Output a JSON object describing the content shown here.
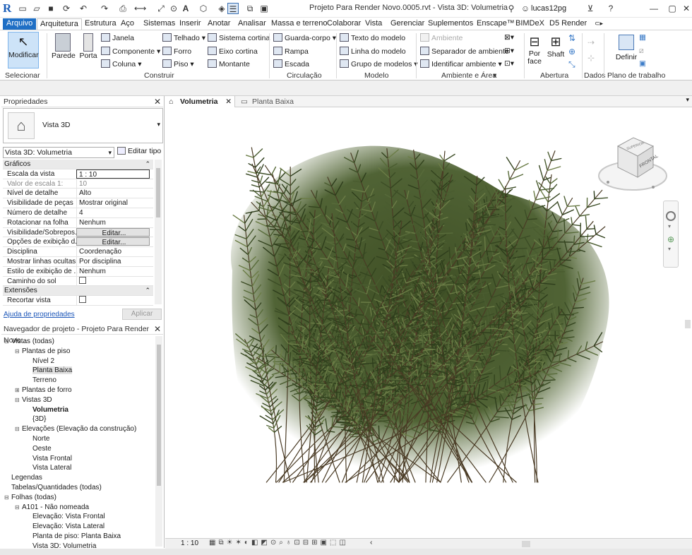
{
  "title_bar": {
    "app_letter": "R",
    "title": "Projeto Para Render Novo.0005.rvt - Vista 3D: Volumetria",
    "user": "lucas12pg"
  },
  "menu": {
    "file": "Arquivo",
    "tabs": [
      "Arquitetura",
      "Estrutura",
      "Aço",
      "Sistemas",
      "Inserir",
      "Anotar",
      "Analisar",
      "Massa e terreno",
      "Colaborar",
      "Vista",
      "Gerenciar",
      "Suplementos",
      "Enscape™",
      "BIMDeX",
      "D5 Render"
    ]
  },
  "ribbon": {
    "modificar": "Modificar",
    "selecionar": "Selecionar",
    "parede": "Parede",
    "porta": "Porta",
    "janela": "Janela",
    "componente": "Componente",
    "coluna": "Coluna",
    "telhado": "Telhado",
    "forro": "Forro",
    "piso": "Piso",
    "sistema_cortina": "Sistema cortina",
    "eixo_cortina": "Eixo cortina",
    "montante": "Montante",
    "construir": "Construir",
    "guarda_corpo": "Guarda-corpo",
    "rampa": "Rampa",
    "escada": "Escada",
    "circulacao": "Circulação",
    "texto_modelo": "Texto do modelo",
    "linha_modelo": "Linha do modelo",
    "grupo_modelos": "Grupo de modelos",
    "modelo": "Modelo",
    "ambiente": "Ambiente",
    "separador_ambiente": "Separador de ambiente",
    "identificar_ambiente": "Identificar ambiente",
    "ambiente_area": "Ambiente e Área",
    "por_face": "Por face",
    "shaft": "Shaft",
    "abertura": "Abertura",
    "dados": "Dados",
    "definir": "Definir",
    "plano_trabalho": "Plano de trabalho"
  },
  "properties": {
    "title": "Propriedades",
    "type_name": "Vista 3D",
    "instance_select": "Vista 3D: Volumetria",
    "edit_type": "Editar tipo",
    "group_graficos": "Gráficos",
    "group_extensoes": "Extensões",
    "rows": [
      {
        "k": "Escala da vista",
        "v": "1 : 10"
      },
      {
        "k": "Valor de escala    1:",
        "v": "10"
      },
      {
        "k": "Nível de detalhe",
        "v": "Alto"
      },
      {
        "k": "Visibilidade de peças",
        "v": "Mostrar original"
      },
      {
        "k": "Número de detalhe",
        "v": "4"
      },
      {
        "k": "Rotacionar na folha",
        "v": "Nenhum"
      },
      {
        "k": "Visibilidade/Sobrepos...",
        "v": "Editar..."
      },
      {
        "k": "Opções de exibição d...",
        "v": "Editar..."
      },
      {
        "k": "Disciplina",
        "v": "Coordenação"
      },
      {
        "k": "Mostrar linhas ocultas",
        "v": "Por disciplina"
      },
      {
        "k": "Estilo de exibição de ...",
        "v": "Nenhum"
      },
      {
        "k": "Caminho do sol",
        "v": ""
      }
    ],
    "ext_rows": [
      {
        "k": "Recortar vista",
        "v": ""
      }
    ],
    "help": "Ajuda de propriedades",
    "apply": "Aplicar"
  },
  "navigator": {
    "title": "Navegador de projeto - Projeto Para Render Novo...",
    "items": [
      {
        "label": "Vistas (todas)",
        "level": 0,
        "glyph": "−"
      },
      {
        "label": "Plantas de piso",
        "level": 1,
        "glyph": "−"
      },
      {
        "label": "Nível 2",
        "level": 2,
        "glyph": ""
      },
      {
        "label": "Planta Baixa",
        "level": 2,
        "glyph": ""
      },
      {
        "label": "Terreno",
        "level": 2,
        "glyph": ""
      },
      {
        "label": "Plantas de forro",
        "level": 1,
        "glyph": "+"
      },
      {
        "label": "Vistas 3D",
        "level": 1,
        "glyph": "−"
      },
      {
        "label": "Volumetria",
        "level": 2,
        "glyph": ""
      },
      {
        "label": "{3D}",
        "level": 2,
        "glyph": ""
      },
      {
        "label": "Elevações (Elevação da construção)",
        "level": 1,
        "glyph": "−"
      },
      {
        "label": "Norte",
        "level": 2,
        "glyph": ""
      },
      {
        "label": "Oeste",
        "level": 2,
        "glyph": ""
      },
      {
        "label": "Vista Frontal",
        "level": 2,
        "glyph": ""
      },
      {
        "label": "Vista Lateral",
        "level": 2,
        "glyph": ""
      },
      {
        "label": "Legendas",
        "level": 0,
        "glyph": ""
      },
      {
        "label": "Tabelas/Quantidades (todas)",
        "level": 0,
        "glyph": ""
      },
      {
        "label": "Folhas (todas)",
        "level": 0,
        "glyph": "−"
      },
      {
        "label": "A101 - Não nomeada",
        "level": 1,
        "glyph": "−"
      },
      {
        "label": "Elevação: Vista Frontal",
        "level": 2,
        "glyph": ""
      },
      {
        "label": "Elevação: Vista Lateral",
        "level": 2,
        "glyph": ""
      },
      {
        "label": "Planta de piso: Planta Baixa",
        "level": 2,
        "glyph": ""
      },
      {
        "label": "Vista 3D: Volumetria",
        "level": 2,
        "glyph": ""
      }
    ]
  },
  "view_tabs": [
    "Volumetria",
    "Planta Baixa"
  ],
  "viewcube": {
    "top": "SUPERIOR",
    "front": "FRONTAL"
  },
  "status": {
    "scale": "1 : 10"
  }
}
